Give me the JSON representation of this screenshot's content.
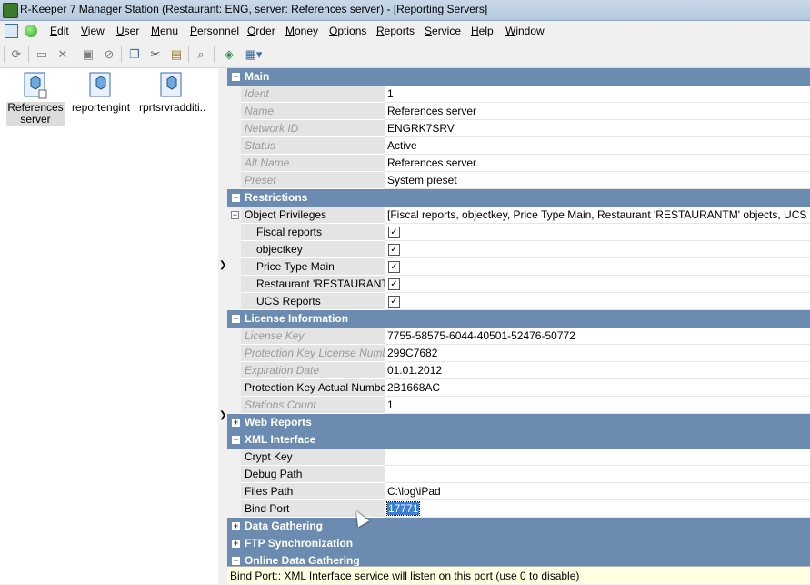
{
  "window": {
    "title": "R-Keeper 7 Manager Station (Restaurant: ENG, server: References server) - [Reporting Servers]"
  },
  "menu": [
    "Edit",
    "View",
    "User",
    "Menu",
    "Personnel",
    "Order",
    "Money",
    "Options",
    "Reports",
    "Service",
    "Help",
    "Window"
  ],
  "toolbar": {
    "icons": [
      "refresh-icon",
      "new-icon",
      "delete-icon",
      "save-icon",
      "cancel-icon",
      "copy-icon",
      "cut-icon",
      "paste-icon",
      "find-icon",
      "export-icon",
      "grid-view-icon"
    ]
  },
  "objects": [
    {
      "label_line1": "References",
      "label_line2": "server",
      "selected": true
    },
    {
      "label_line1": "reportengint...",
      "label_line2": "",
      "selected": false
    },
    {
      "label_line1": "rprtsrvradditi...",
      "label_line2": "",
      "selected": false
    }
  ],
  "grid": {
    "main": {
      "title": "Main",
      "rows": [
        {
          "name": "Ident",
          "value": "1"
        },
        {
          "name": "Name",
          "value": "References server"
        },
        {
          "name": "Network ID",
          "value": "ENGRK7SRV"
        },
        {
          "name": "Status",
          "value": "Active"
        },
        {
          "name": "Alt Name",
          "value": "References server"
        },
        {
          "name": "Preset",
          "value": "System preset"
        }
      ]
    },
    "restrictions": {
      "title": "Restrictions",
      "object_privileges": {
        "name": "Object Privileges",
        "value": "[Fiscal reports, objectkey, Price Type Main, Restaurant 'RESTAURANTM' objects, UCS Reports]"
      },
      "items": [
        {
          "name": "Fiscal reports",
          "checked": true
        },
        {
          "name": "objectkey",
          "checked": true
        },
        {
          "name": "Price Type Main",
          "checked": true
        },
        {
          "name": "Restaurant 'RESTAURANTM' objects",
          "checked": true
        },
        {
          "name": "UCS Reports",
          "checked": true
        }
      ]
    },
    "license": {
      "title": "License Information",
      "rows": [
        {
          "name": "License Key",
          "value": "7755-58575-6044-40501-52476-50772",
          "readonly": true
        },
        {
          "name": "Protection Key License Number",
          "value": "299C7682",
          "readonly": true
        },
        {
          "name": "Expiration Date",
          "value": "01.01.2012",
          "readonly": true
        },
        {
          "name": "Protection Key Actual Number",
          "value": "2B1668AC",
          "readonly": false
        },
        {
          "name": "Stations Count",
          "value": "1",
          "readonly": true
        }
      ]
    },
    "web_reports": {
      "title": "Web Reports"
    },
    "xml_interface": {
      "title": "XML Interface",
      "rows": [
        {
          "name": "Crypt Key",
          "value": ""
        },
        {
          "name": "Debug Path",
          "value": ""
        },
        {
          "name": "Files Path",
          "value": "C:\\log\\iPad"
        },
        {
          "name": "Bind Port",
          "value": "17771"
        }
      ]
    },
    "data_gathering": {
      "title": "Data Gathering"
    },
    "ftp_sync": {
      "title": "FTP Synchronization"
    },
    "online_data": {
      "title": "Online Data Gathering"
    }
  },
  "status": {
    "hint": "Bind Port:: XML Interface service will listen on this port (use 0 to disable)"
  },
  "colors": {
    "section_header": "#6c8bb0",
    "name_cell": "#e4e4e4",
    "selection": "#3b7fd4",
    "status_bg": "#ffffe1"
  }
}
